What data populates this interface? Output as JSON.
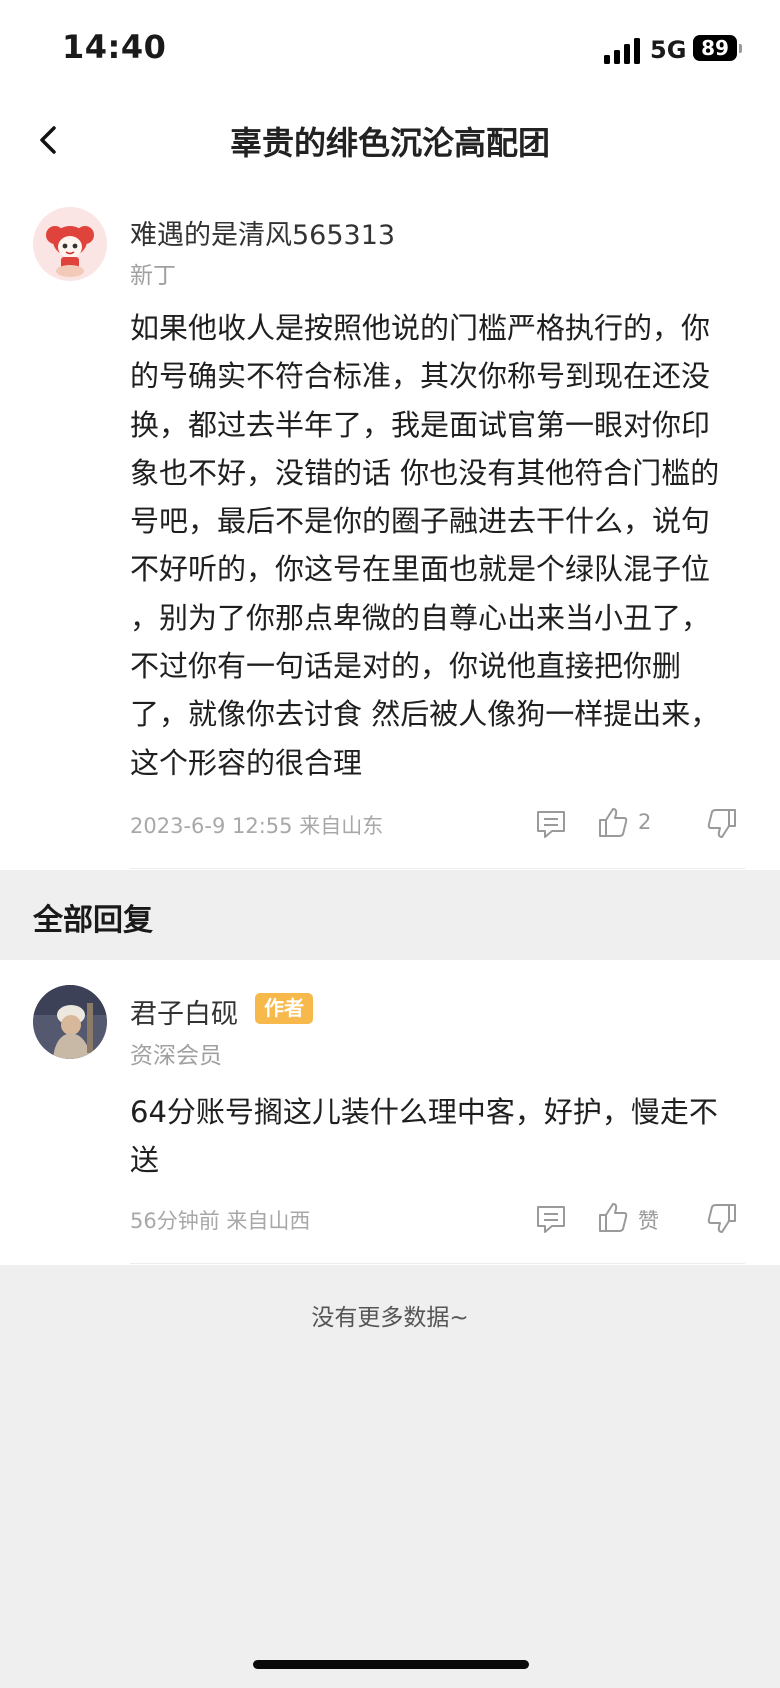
{
  "status_bar": {
    "time": "14:40",
    "network": "5G",
    "battery": "89"
  },
  "header": {
    "title": "辜贵的绯色沉沦高配团"
  },
  "main_post": {
    "username": "难遇的是清风565313",
    "rank": "新丁",
    "lines": [
      "如果他收人是按照他说的门槛严格执行的，你",
      "的号确实不符合标准，其次你称号到现在还没",
      "换，都过去半年了，我是面试官第一眼对你印",
      "象也不好，没错的话 你也没有其他符合门槛的",
      "号吧，最后不是你的圈子融进去干什么，说句",
      "不好听的，你这号在里面也就是个绿队混子位",
      "，别为了你那点卑微的自尊心出来当小丑了，",
      "不过你有一句话是对的，你说他直接把你删",
      "了，就像你去讨食 然后被人像狗一样提出来，",
      "这个形容的很合理"
    ],
    "meta": "2023-6-9 12:55  来自山东",
    "like_count": "2"
  },
  "section": {
    "title": "全部回复"
  },
  "reply": {
    "username": "君子白砚",
    "author_tag": "作者",
    "rank": "资深会员",
    "lines": [
      "64分账号搁这儿装什么理中客，好护，慢走不",
      "送"
    ],
    "meta": "56分钟前 来自山西",
    "like_label": "赞"
  },
  "footer": {
    "no_more": "没有更多数据~"
  }
}
